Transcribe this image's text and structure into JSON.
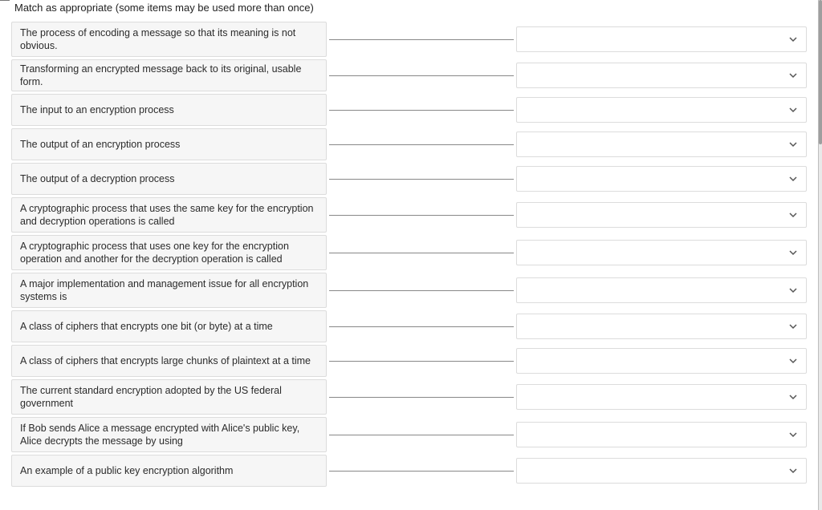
{
  "instruction": "Match as appropriate (some items may be used more than once)",
  "items": [
    {
      "prompt": "The process of encoding a message so that its meaning is not obvious.",
      "selected": ""
    },
    {
      "prompt": "Transforming an encrypted message back to its original, usable form.",
      "selected": ""
    },
    {
      "prompt": "The input to an encryption process",
      "selected": ""
    },
    {
      "prompt": "The output of an encryption process",
      "selected": ""
    },
    {
      "prompt": "The output of a decryption process",
      "selected": ""
    },
    {
      "prompt": "A cryptographic process that uses the same key for the encryption and decryption operations is called",
      "selected": ""
    },
    {
      "prompt": "A cryptographic process that uses one key for the encryption operation and another for the decryption operation is called",
      "selected": ""
    },
    {
      "prompt": "A major implementation and management issue for all encryption systems is",
      "selected": ""
    },
    {
      "prompt": "A class of ciphers that encrypts one bit (or byte) at a time",
      "selected": ""
    },
    {
      "prompt": "A class of ciphers that encrypts large chunks of plaintext at a time",
      "selected": ""
    },
    {
      "prompt": "The current standard encryption adopted by the US federal government",
      "selected": ""
    },
    {
      "prompt": "If Bob sends Alice a message encrypted with Alice's public key, Alice decrypts the message by using",
      "selected": ""
    },
    {
      "prompt": "An example of a public key encryption algorithm",
      "selected": ""
    }
  ]
}
